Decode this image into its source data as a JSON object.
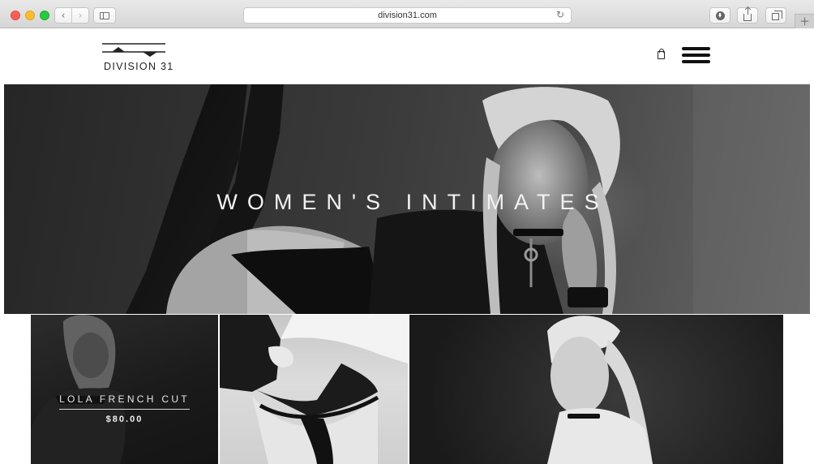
{
  "browser": {
    "url": "division31.com",
    "back_glyph": "‹",
    "forward_glyph": "›",
    "reload_glyph": "↻",
    "new_tab_glyph": "+",
    "icons": [
      "back-arrow-icon",
      "forward-arrow-icon",
      "sidebar-icon",
      "reload-icon",
      "download-icon",
      "share-icon",
      "tabs-icon",
      "plus-icon"
    ]
  },
  "site": {
    "logo_text": "DIVISION 31",
    "icons": [
      "shopping-bag-icon",
      "hamburger-menu-icon"
    ]
  },
  "hero": {
    "title": "WOMEN'S INTIMATES"
  },
  "products": [
    {
      "name": "LOLA FRENCH CUT",
      "price": "$80.00"
    }
  ],
  "colors": {
    "chrome_bg": "#e0e0e0",
    "traffic_red": "#fc5f57",
    "traffic_yellow": "#fdbc2e",
    "traffic_green": "#29c840",
    "hero_text": "#f2f2f2",
    "logo_ink": "#222222"
  }
}
